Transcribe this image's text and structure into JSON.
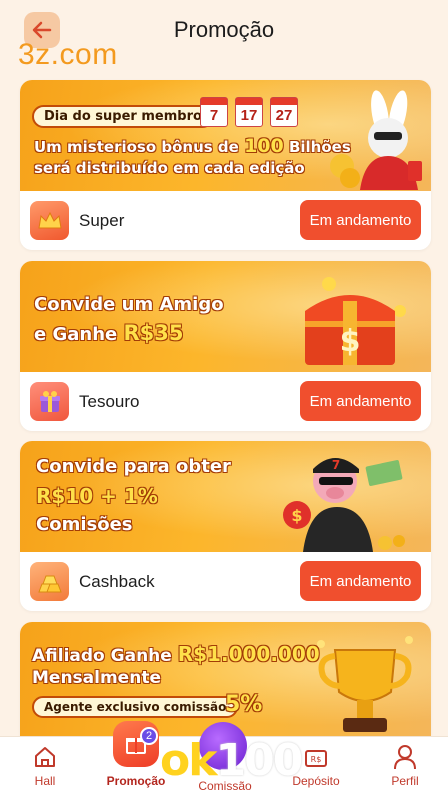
{
  "header": {
    "title": "Promoção",
    "watermark": "3z.com"
  },
  "cards": [
    {
      "banner": {
        "pill": "Dia do super membro",
        "calendar": [
          "7",
          "17",
          "27"
        ],
        "line1_a": "Um misterioso bônus de ",
        "line1_num": "100",
        "line1_b": " Bilhões",
        "line2": "será distribuído em cada edição"
      },
      "label": "Super",
      "status": "Em andamento"
    },
    {
      "banner": {
        "line1": "Convide um Amigo",
        "line2_a": "e Ganhe ",
        "line2_b": "R$35"
      },
      "label": "Tesouro",
      "status": "Em andamento"
    },
    {
      "banner": {
        "line1": "Convide para obter",
        "line2": "R$10 + 1%",
        "line3": "Comisões"
      },
      "label": "Cashback",
      "status": "Em andamento"
    },
    {
      "banner": {
        "line1_a": "Afiliado Ganhe ",
        "line1_b": "R$1.000.000",
        "line2": "Mensalmente",
        "pill": "Agente exclusivo comissão",
        "pct": "5%"
      }
    }
  ],
  "tabbar": {
    "items": [
      {
        "label": "Hall",
        "icon": "home-icon"
      },
      {
        "label": "Promoção",
        "icon": "gift-icon",
        "badge": "2",
        "active": true
      },
      {
        "label": "Comissão",
        "icon": "coin-icon"
      },
      {
        "label": "Depósito",
        "icon": "wallet-icon"
      },
      {
        "label": "Perfil",
        "icon": "user-icon"
      }
    ],
    "overlay_logo_a": "ok",
    "overlay_logo_b": "100"
  },
  "colors": {
    "accent": "#f04f2e",
    "background": "#fdf2e6",
    "tab_text": "#c0392b"
  }
}
